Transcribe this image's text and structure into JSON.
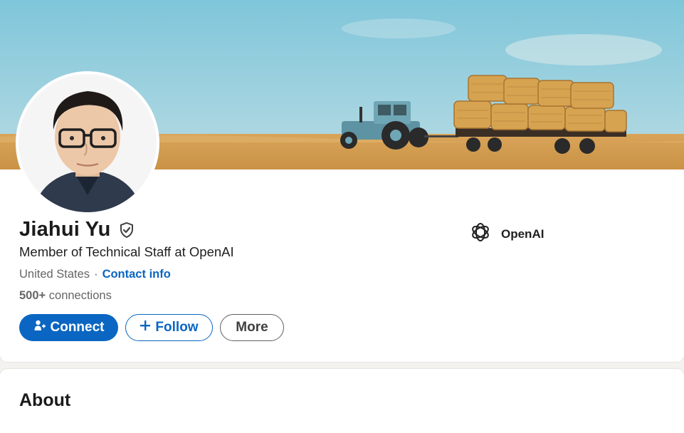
{
  "profile": {
    "name": "Jiahui Yu",
    "headline": "Member of Technical Staff at OpenAI",
    "location": "United States",
    "separator": "·",
    "contact_info_label": "Contact info",
    "connections_count": "500+",
    "connections_label": "connections"
  },
  "actions": {
    "connect_label": "Connect",
    "follow_label": "Follow",
    "more_label": "More"
  },
  "company": {
    "name": "OpenAI",
    "logo_icon": "openai-logo-icon"
  },
  "about": {
    "title": "About"
  },
  "icons": {
    "verified": "verified-shield-icon",
    "connect": "add-person-icon",
    "follow": "plus-icon"
  },
  "colors": {
    "brand_blue": "#0a66c2",
    "page_background": "#f4f2ee"
  }
}
